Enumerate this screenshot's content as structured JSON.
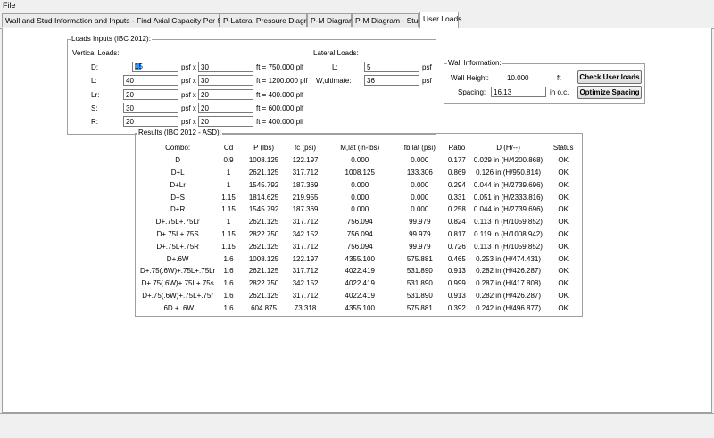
{
  "menu": {
    "file": "File"
  },
  "tabs": [
    {
      "label": "Wall and Stud Information and Inputs - Find Axial Capacity Per Stud"
    },
    {
      "label": "P-Lateral Pressure Diagram"
    },
    {
      "label": "P-M Diagram"
    },
    {
      "label": "P-M Diagram - Stud"
    },
    {
      "label": "User Loads"
    }
  ],
  "loads": {
    "title": "Loads Inputs (IBC 2012):",
    "vertical_title": "Vertical Loads:",
    "rows": [
      {
        "label": "D:",
        "value": "15",
        "unit1": "psf x",
        "width": "30",
        "result": "ft = 750.000 plf"
      },
      {
        "label": "L:",
        "value": "40",
        "unit1": "psf x",
        "width": "30",
        "result": "ft = 1200.000 plf"
      },
      {
        "label": "Lr:",
        "value": "20",
        "unit1": "psf x",
        "width": "20",
        "result": "ft = 400.000 plf"
      },
      {
        "label": "S:",
        "value": "30",
        "unit1": "psf x",
        "width": "20",
        "result": "ft = 600.000 plf"
      },
      {
        "label": "R:",
        "value": "20",
        "unit1": "psf x",
        "width": "20",
        "result": "ft = 400.000 plf"
      }
    ],
    "lateral_title": "Lateral Loads:",
    "lateral": [
      {
        "label": "L:",
        "value": "5",
        "unit": "psf"
      },
      {
        "label": "W,ultimate:",
        "value": "36",
        "unit": "psf"
      }
    ]
  },
  "wall": {
    "title": "Wall Information:",
    "height_label": "Wall Height:",
    "height_value": "10.000",
    "height_unit": "ft",
    "spacing_label": "Spacing:",
    "spacing_value": "16.13",
    "spacing_unit": "in o.c.",
    "check_btn": "Check User loads",
    "optimize_btn": "Optimize Spacing"
  },
  "results": {
    "title": "Results (IBC 2012 - ASD):",
    "headers": [
      "Combo:",
      "Cd",
      "P (lbs)",
      "fc (psi)",
      "M,lat (in-lbs)",
      "fb,lat (psi)",
      "Ratio",
      "D (H/--)",
      "Status"
    ],
    "rows": [
      [
        "D",
        "0.9",
        "1008.125",
        "122.197",
        "0.000",
        "0.000",
        "0.177",
        "0.029 in (H/4200.868)",
        "OK"
      ],
      [
        "D+L",
        "1",
        "2621.125",
        "317.712",
        "1008.125",
        "133.306",
        "0.869",
        "0.126 in (H/950.814)",
        "OK"
      ],
      [
        "D+Lr",
        "1",
        "1545.792",
        "187.369",
        "0.000",
        "0.000",
        "0.294",
        "0.044 in (H/2739.696)",
        "OK"
      ],
      [
        "D+S",
        "1.15",
        "1814.625",
        "219.955",
        "0.000",
        "0.000",
        "0.331",
        "0.051 in (H/2333.816)",
        "OK"
      ],
      [
        "D+R",
        "1.15",
        "1545.792",
        "187.369",
        "0.000",
        "0.000",
        "0.258",
        "0.044 in (H/2739.696)",
        "OK"
      ],
      [
        "D+.75L+.75Lr",
        "1",
        "2621.125",
        "317.712",
        "756.094",
        "99.979",
        "0.824",
        "0.113 in (H/1059.852)",
        "OK"
      ],
      [
        "D+.75L+.75S",
        "1.15",
        "2822.750",
        "342.152",
        "756.094",
        "99.979",
        "0.817",
        "0.119 in (H/1008.942)",
        "OK"
      ],
      [
        "D+.75L+.75R",
        "1.15",
        "2621.125",
        "317.712",
        "756.094",
        "99.979",
        "0.726",
        "0.113 in (H/1059.852)",
        "OK"
      ],
      [
        "D+.6W",
        "1.6",
        "1008.125",
        "122.197",
        "4355.100",
        "575.881",
        "0.465",
        "0.253 in (H/474.431)",
        "OK"
      ],
      [
        "D+.75(.6W)+.75L+.75Lr",
        "1.6",
        "2621.125",
        "317.712",
        "4022.419",
        "531.890",
        "0.913",
        "0.282 in (H/426.287)",
        "OK"
      ],
      [
        "D+.75(.6W)+.75L+.75s",
        "1.6",
        "2822.750",
        "342.152",
        "4022.419",
        "531.890",
        "0.999",
        "0.287 in (H/417.808)",
        "OK"
      ],
      [
        "D+.75(.6W)+.75L+.75r",
        "1.6",
        "2621.125",
        "317.712",
        "4022.419",
        "531.890",
        "0.913",
        "0.282 in (H/426.287)",
        "OK"
      ],
      [
        ".6D + .6W",
        "1.6",
        "604.875",
        "73.318",
        "4355.100",
        "575.881",
        "0.392",
        "0.242 in (H/496.877)",
        "OK"
      ]
    ]
  }
}
